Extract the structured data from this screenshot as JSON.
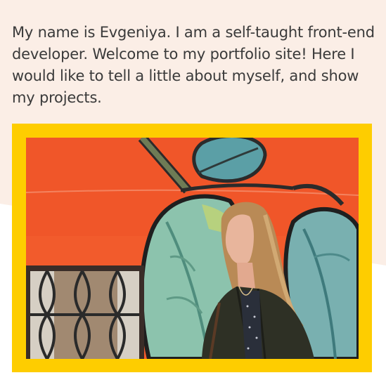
{
  "intro": {
    "text": "My name is Evgeniya. I am a self-taught front-end developer. Welcome to my portfolio site! Here I would like to tell a little about myself, and show my projects."
  },
  "colors": {
    "page_background": "#ffffff",
    "accent_background": "#fbeee6",
    "frame": "#fecd00",
    "text": "#3a3a3a",
    "mural_wall": "#f25b2c"
  },
  "photo": {
    "icon": "portrait-photo-icon"
  }
}
